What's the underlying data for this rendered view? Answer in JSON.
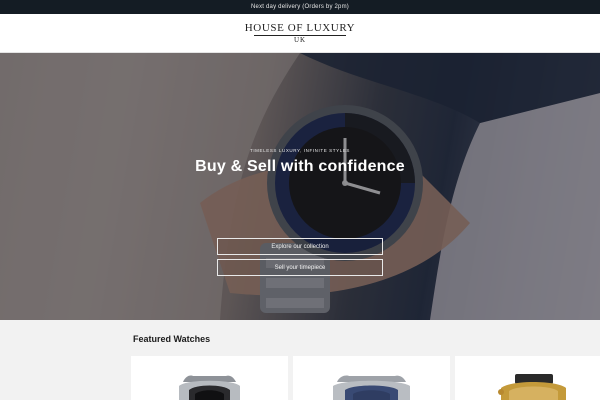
{
  "announcement": "Next day delivery (Orders by 2pm)",
  "brand": {
    "name": "HOUSE OF LUXURY",
    "region": "UK"
  },
  "hero": {
    "kicker": "Timeless luxury, infinite styles",
    "title": "Buy & Sell with confidence",
    "buttons": [
      {
        "label": "Explore our collection"
      },
      {
        "label": "Sell your timepiece"
      }
    ]
  },
  "featured": {
    "title": "Featured Watches",
    "products": [
      {
        "image": "steel-watch-black-dial"
      },
      {
        "image": "steel-watch-blue-dial"
      },
      {
        "image": "gold-watch-leather-strap"
      }
    ]
  },
  "colors": {
    "announcement_bg": "#141c24",
    "header_bg": "#ffffff",
    "section_bg": "#f2f2f2",
    "text_dark": "#1b1b1b"
  }
}
